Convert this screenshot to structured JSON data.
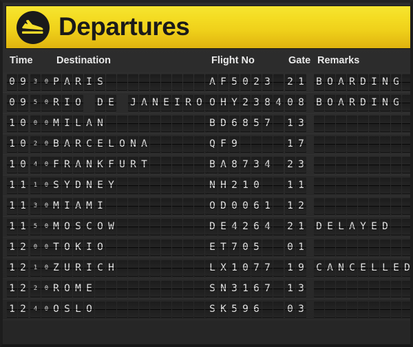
{
  "header": {
    "title": "Departures",
    "logo_icon": "departing-plane-icon",
    "background_color_top": "#f6e531",
    "background_color_bottom": "#dfb40f",
    "icon_color": "#1a1a1a"
  },
  "columns": [
    {
      "key": "time",
      "label": "Time"
    },
    {
      "key": "destination",
      "label": "Destination"
    },
    {
      "key": "flight_no",
      "label": "Flight No"
    },
    {
      "key": "gate",
      "label": "Gate"
    },
    {
      "key": "remarks",
      "label": "Remarks"
    }
  ],
  "cell_counts": {
    "time_hour": 2,
    "time_minute": 2,
    "destination": 15,
    "flight_no": 7,
    "gate": 2,
    "remarks": 11
  },
  "board_colors": {
    "board_background": "#2a2a2a",
    "flap_face": "#222222",
    "flap_text": "#e2e2e2",
    "header_text": "#e9e9e9"
  },
  "flights": [
    {
      "hour": "09",
      "minute": "30",
      "time": "09:30",
      "destination": "PARIS",
      "flight_no": "AF5023",
      "gate": "21",
      "remarks": "BOARDING"
    },
    {
      "hour": "09",
      "minute": "50",
      "time": "09:50",
      "destination": "RIO DE JANEIRO",
      "flight_no": "OHY2384",
      "gate": "08",
      "remarks": "BOARDING"
    },
    {
      "hour": "10",
      "minute": "00",
      "time": "10:00",
      "destination": "MILAN",
      "flight_no": "BD6857",
      "gate": "13",
      "remarks": ""
    },
    {
      "hour": "10",
      "minute": "20",
      "time": "10:20",
      "destination": "BARCELONA",
      "flight_no": "QF9",
      "gate": "17",
      "remarks": ""
    },
    {
      "hour": "10",
      "minute": "40",
      "time": "10:40",
      "destination": "FRANKFURT",
      "flight_no": "BA8734",
      "gate": "23",
      "remarks": ""
    },
    {
      "hour": "11",
      "minute": "10",
      "time": "11:10",
      "destination": "SYDNEY",
      "flight_no": "NH210",
      "gate": "11",
      "remarks": ""
    },
    {
      "hour": "11",
      "minute": "30",
      "time": "11:30",
      "destination": "MIAMI",
      "flight_no": "OD0061",
      "gate": "12",
      "remarks": ""
    },
    {
      "hour": "11",
      "minute": "50",
      "time": "11:50",
      "destination": "MOSCOW",
      "flight_no": "DE4264",
      "gate": "21",
      "remarks": "DELAYED"
    },
    {
      "hour": "12",
      "minute": "00",
      "time": "12:00",
      "destination": "TOKIO",
      "flight_no": "ET705",
      "gate": "01",
      "remarks": ""
    },
    {
      "hour": "12",
      "minute": "10",
      "time": "12:10",
      "destination": "ZURICH",
      "flight_no": "LX1077",
      "gate": "19",
      "remarks": "CANCELLED"
    },
    {
      "hour": "12",
      "minute": "20",
      "time": "12:20",
      "destination": "ROME",
      "flight_no": "SN3167",
      "gate": "13",
      "remarks": ""
    },
    {
      "hour": "12",
      "minute": "40",
      "time": "12:40",
      "destination": "OSLO",
      "flight_no": "SK596",
      "gate": "03",
      "remarks": ""
    }
  ]
}
